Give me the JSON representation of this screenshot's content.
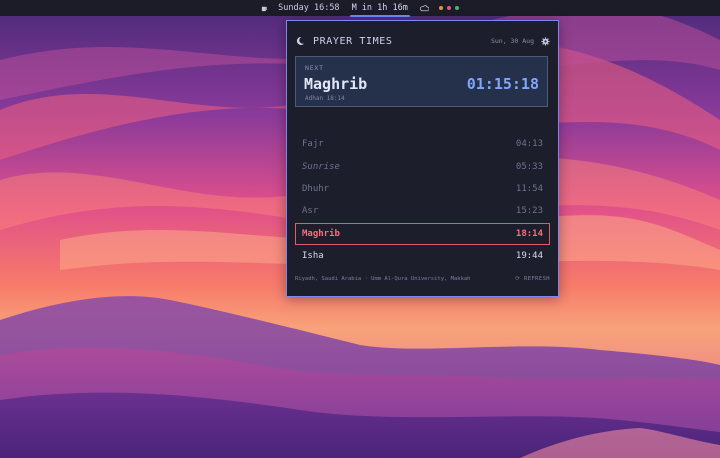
{
  "topbar": {
    "app_icon": "mug-icon",
    "clock": "Sunday 16:58",
    "countdown": "M in 1h 16m",
    "weather_icon": "cloud-icon",
    "status_dots": [
      "#e7953b",
      "#e35b7a",
      "#49b86a"
    ]
  },
  "panel": {
    "title": "PRAYER TIMES",
    "date": "Sun, 30 Aug",
    "moon_icon": "crescent-moon-icon",
    "settings_icon": "gear-icon",
    "accent_color": "#7d86f2"
  },
  "next": {
    "label": "NEXT",
    "name": "Maghrib",
    "countdown": "01:15:18",
    "adhan": "Adhan 18:14"
  },
  "prayers": [
    {
      "name": "Fajr",
      "time": "04:13",
      "state": "past"
    },
    {
      "name": "Sunrise",
      "time": "05:33",
      "state": "past-italic"
    },
    {
      "name": "Dhuhr",
      "time": "11:54",
      "state": "past"
    },
    {
      "name": "Asr",
      "time": "15:23",
      "state": "past"
    },
    {
      "name": "Maghrib",
      "time": "18:14",
      "state": "current"
    },
    {
      "name": "Isha",
      "time": "19:44",
      "state": "upcoming"
    }
  ],
  "footer": {
    "location": "Riyadh, Saudi Arabia · Umm Al-Qura University, Makkah",
    "refresh": "⟳ REFRESH"
  }
}
